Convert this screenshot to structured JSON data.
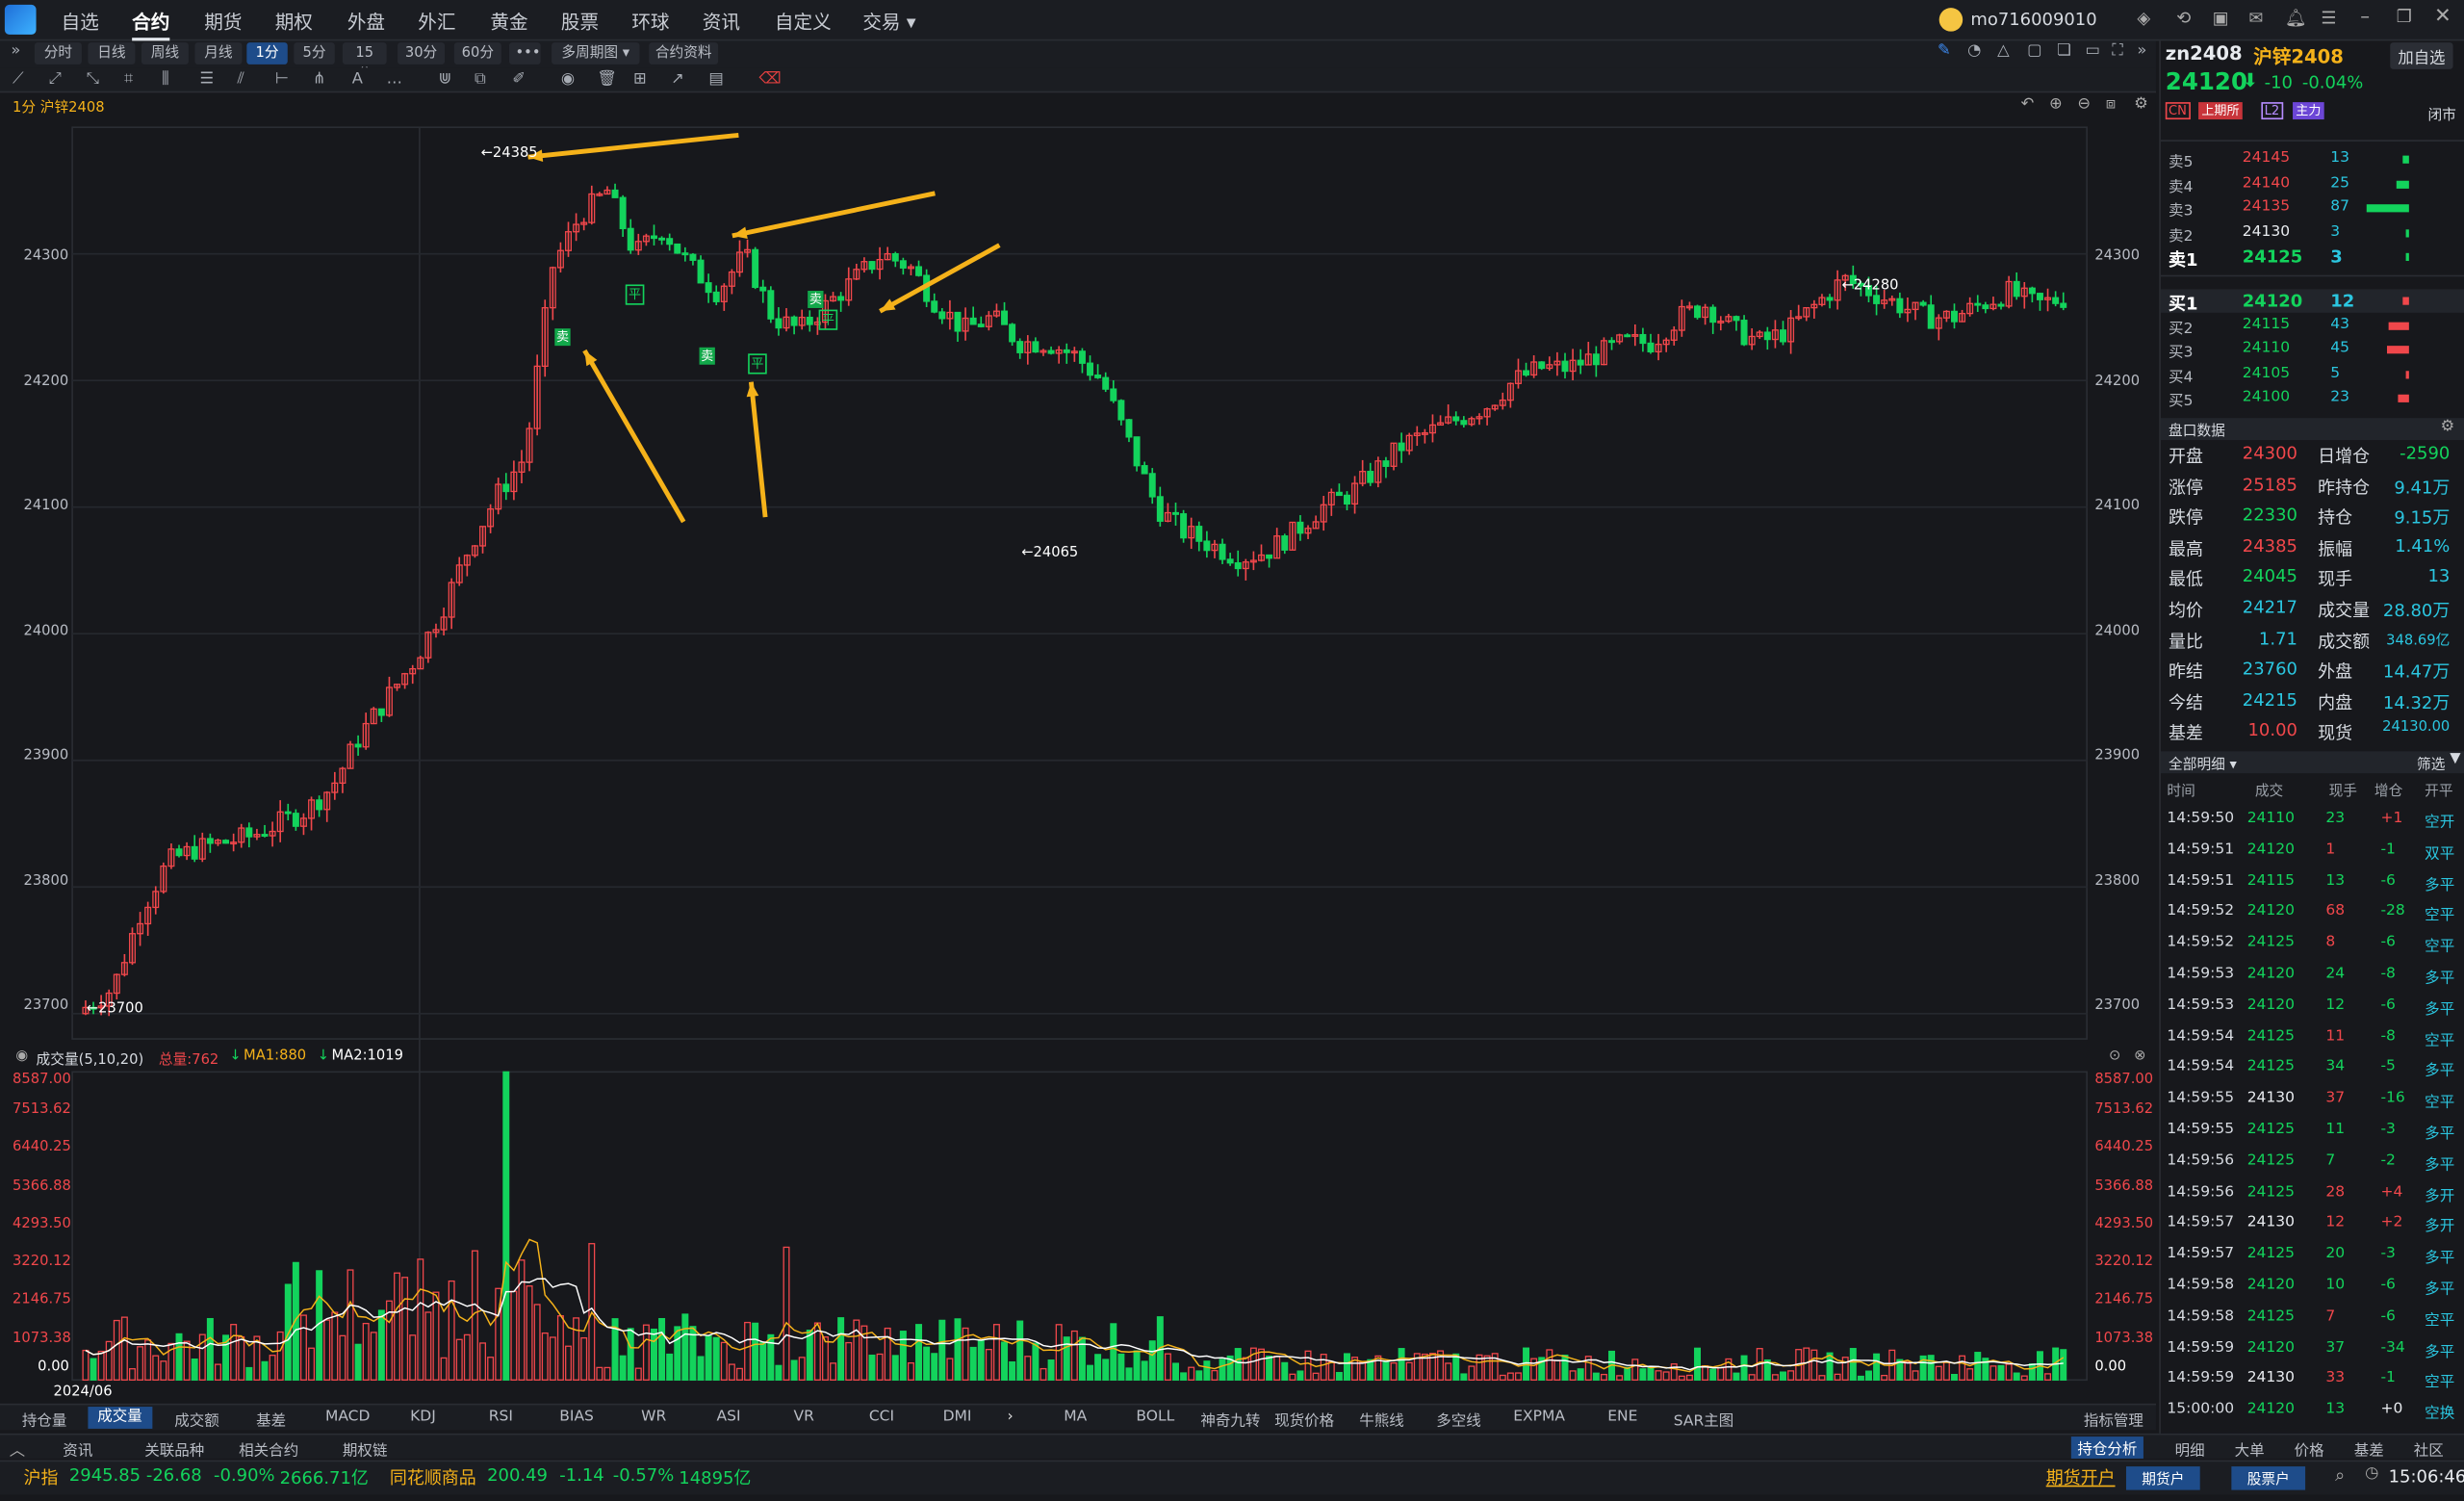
{
  "menubar": {
    "items": [
      "自选",
      "合约",
      "期货",
      "期权",
      "外盘",
      "外汇",
      "黄金",
      "股票",
      "环球",
      "资讯",
      "自定义",
      "交易 ▾"
    ],
    "active_index": 1,
    "username": "mo716009010"
  },
  "toolbar": {
    "periods": [
      "分时",
      "日线",
      "周线",
      "月线",
      "1分",
      "5分",
      "15分",
      "30分",
      "60分",
      "•••",
      "多周期图 ▾",
      "合约资料"
    ],
    "selected_period": "1分"
  },
  "chart": {
    "title": "1分 沪锌2408",
    "y_ticks": [
      "24300",
      "24200",
      "24100",
      "24000",
      "23900",
      "23800",
      "23700"
    ],
    "high_label": "←24385",
    "low_label": "←23700",
    "mid_low_label": "←24065",
    "late_high_label": "←24280",
    "signal_labels": [
      "卖",
      "平",
      "卖",
      "平",
      "卖",
      "平"
    ]
  },
  "volume_panel": {
    "title": "成交量(5,10,20)",
    "total": "总量:762",
    "ma1": "MA1:880",
    "ma2": "MA2:1019",
    "y_ticks": [
      "8587.00",
      "7513.62",
      "6440.25",
      "5366.88",
      "4293.50",
      "3220.12",
      "2146.75",
      "1073.38",
      "0.00"
    ],
    "date_label": "2024/06"
  },
  "indicator_tabs": [
    "持仓量",
    "成交量",
    "成交额",
    "基差",
    "MACD",
    "KDJ",
    "RSI",
    "BIAS",
    "WR",
    "ASI",
    "VR",
    "CCI",
    "DMI"
  ],
  "indicator_tabs_selected": "成交量",
  "overlay_tabs": [
    "MA",
    "BOLL",
    "神奇九转",
    "现货价格",
    "牛熊线",
    "多空线",
    "EXPMA",
    "ENE",
    "SAR主图"
  ],
  "indicator_manage": "指标管理",
  "bottom_tabs": [
    "资讯",
    "关联品种",
    "相关合约",
    "期权链"
  ],
  "bottom_right_tabs": [
    "持仓分析",
    "明细",
    "大单",
    "价格",
    "基差",
    "社区"
  ],
  "status": {
    "index_name": "沪指",
    "index_value": "2945.85",
    "index_change": "-26.68",
    "index_pct": "-0.90%",
    "index_amount": "2666.71亿",
    "commodity_name": "同花顺商品",
    "commodity_value": "200.49",
    "commodity_change": "-1.14",
    "commodity_pct": "-0.57%",
    "commodity_amount": "14895亿",
    "open_futures": "期货开户",
    "futures_account": "期货户",
    "stock_account": "股票户",
    "time": "15:06:46"
  },
  "quote": {
    "code": "zn2408",
    "name": "沪锌2408",
    "add_button": "加自选",
    "price": "24120",
    "arrow": "⬇",
    "change": "-10",
    "pct": "-0.04%",
    "tags": [
      "CN",
      "上期所",
      "L2",
      "主力"
    ],
    "market_status": "闭市",
    "asks": [
      {
        "label": "卖5",
        "price": "24145",
        "vol": "13"
      },
      {
        "label": "卖4",
        "price": "24140",
        "vol": "25"
      },
      {
        "label": "卖3",
        "price": "24135",
        "vol": "87"
      },
      {
        "label": "卖2",
        "price": "24130",
        "vol": "3"
      },
      {
        "label": "卖1",
        "price": "24125",
        "vol": "3"
      }
    ],
    "bids": [
      {
        "label": "买1",
        "price": "24120",
        "vol": "12"
      },
      {
        "label": "买2",
        "price": "24115",
        "vol": "43"
      },
      {
        "label": "买3",
        "price": "24110",
        "vol": "45"
      },
      {
        "label": "买4",
        "price": "24105",
        "vol": "5"
      },
      {
        "label": "买5",
        "price": "24100",
        "vol": "23"
      }
    ],
    "panel_title": "盘口数据",
    "stats": [
      [
        "开盘",
        "24300",
        "日增仓",
        "-2590"
      ],
      [
        "涨停",
        "25185",
        "昨持仓",
        "9.41万"
      ],
      [
        "跌停",
        "22330",
        "持仓",
        "9.15万"
      ],
      [
        "最高",
        "24385",
        "振幅",
        "1.41%"
      ],
      [
        "最低",
        "24045",
        "现手",
        "13"
      ],
      [
        "均价",
        "24217",
        "成交量",
        "28.80万"
      ],
      [
        "量比",
        "1.71",
        "成交额",
        "348.69亿"
      ],
      [
        "昨结",
        "23760",
        "外盘",
        "14.47万"
      ],
      [
        "今结",
        "24215",
        "内盘",
        "14.32万"
      ],
      [
        "基差",
        "10.00",
        "现货",
        "24130.00"
      ]
    ],
    "detail_title": "全部明细 ▾",
    "filter": "筛选",
    "detail_headers": [
      "时间",
      "成交",
      "现手",
      "增仓",
      "开平"
    ],
    "ticks": [
      [
        "14:59:50",
        "24110",
        "23",
        "+1",
        "空开"
      ],
      [
        "14:59:51",
        "24120",
        "1",
        "-1",
        "双平"
      ],
      [
        "14:59:51",
        "24115",
        "13",
        "-6",
        "多平"
      ],
      [
        "14:59:52",
        "24120",
        "68",
        "-28",
        "空平"
      ],
      [
        "14:59:52",
        "24125",
        "8",
        "-6",
        "空平"
      ],
      [
        "14:59:53",
        "24120",
        "24",
        "-8",
        "多平"
      ],
      [
        "14:59:53",
        "24120",
        "12",
        "-6",
        "多平"
      ],
      [
        "14:59:54",
        "24125",
        "11",
        "-8",
        "空平"
      ],
      [
        "14:59:54",
        "24125",
        "34",
        "-5",
        "多平"
      ],
      [
        "14:59:55",
        "24130",
        "37",
        "-16",
        "空平"
      ],
      [
        "14:59:55",
        "24125",
        "11",
        "-3",
        "多平"
      ],
      [
        "14:59:56",
        "24125",
        "7",
        "-2",
        "多平"
      ],
      [
        "14:59:56",
        "24125",
        "28",
        "+4",
        "多开"
      ],
      [
        "14:59:57",
        "24130",
        "12",
        "+2",
        "多开"
      ],
      [
        "14:59:57",
        "24125",
        "20",
        "-3",
        "多平"
      ],
      [
        "14:59:58",
        "24120",
        "10",
        "-6",
        "多平"
      ],
      [
        "14:59:58",
        "24125",
        "7",
        "-6",
        "空平"
      ],
      [
        "14:59:59",
        "24120",
        "37",
        "-34",
        "多平"
      ],
      [
        "14:59:59",
        "24130",
        "33",
        "-1",
        "空平"
      ],
      [
        "15:00:00",
        "24120",
        "13",
        "+0",
        "空换"
      ]
    ]
  },
  "chart_data": {
    "type": "candlestick",
    "series": [
      {
        "name": "K线(1分) 收盘价",
        "values": [
          23705,
          23720,
          23780,
          23820,
          23830,
          23835,
          23840,
          23850,
          23860,
          23880,
          23920,
          23950,
          23980,
          24020,
          24070,
          24110,
          24140,
          24290,
          24330,
          24350,
          24300,
          24320,
          24290,
          24270,
          24300,
          24250,
          24240,
          24260,
          24280,
          24300,
          24290,
          24260,
          24240,
          24250,
          24230,
          24230,
          24220,
          24200,
          24150,
          24100,
          24080,
          24070,
          24060,
          24065,
          24080,
          24100,
          24110,
          24130,
          24150,
          24160,
          24170,
          24180,
          24200,
          24210,
          24210,
          24220,
          24230,
          24230,
          24250,
          24260,
          24240,
          24230,
          24240,
          24260,
          24280,
          24270,
          24260,
          24250,
          24250,
          24260,
          24270,
          24260,
          24265
        ]
      }
    ],
    "ylim": [
      23680,
      24400
    ],
    "volume": {
      "ylim": [
        0,
        8587
      ],
      "series_names": [
        "MA1",
        "MA2"
      ]
    }
  },
  "colors": {
    "up": "#f0474b",
    "down": "#13d35c",
    "ma1": "#f5b21a",
    "ma2": "#ffffff",
    "accent": "#1e4c8a",
    "arrow": "#f5b21a"
  }
}
